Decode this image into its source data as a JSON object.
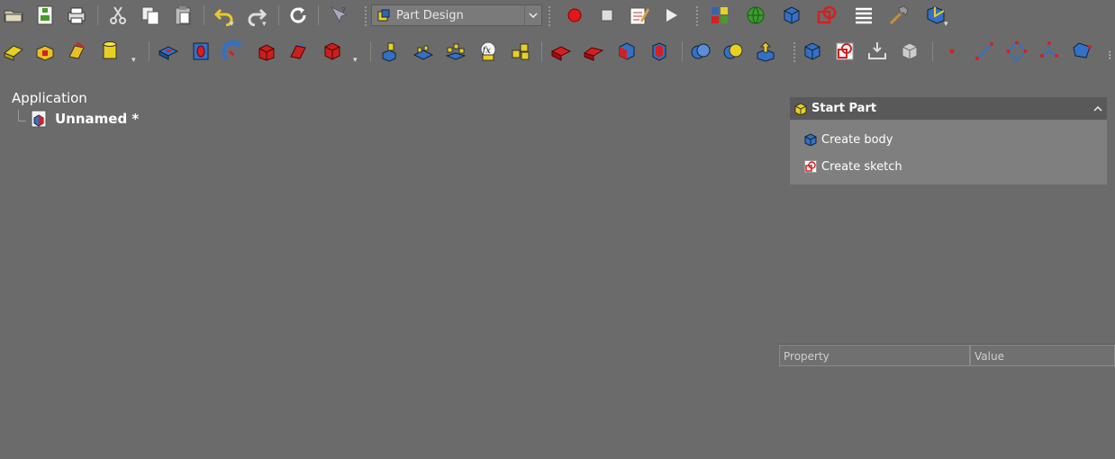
{
  "workbench_selector": {
    "selected": "Part Design"
  },
  "toolbar_main": {
    "icons": [
      "open-folder-icon",
      "save-icon",
      "print-icon",
      "cut-icon",
      "copy-icon",
      "paste-icon",
      "undo-icon",
      "redo-icon",
      "refresh-icon",
      "whats-this-icon",
      "macro-record-icon",
      "macro-stop-icon",
      "macro-edit-icon",
      "macro-run-icon",
      "part-icon",
      "sphere-icon",
      "cube-view-icon",
      "sketch-view-icon",
      "list-icon",
      "hammer-icon",
      "measure-icon"
    ]
  },
  "tree": {
    "root_label": "Application",
    "document_label": "Unnamed *"
  },
  "task_panel": {
    "title": "Start Part",
    "items": [
      {
        "label": "Create body"
      },
      {
        "label": "Create sketch"
      }
    ]
  },
  "property_view": {
    "col_property": "Property",
    "col_value": "Value"
  },
  "colors": {
    "background": "#6b6b6b",
    "accent_red": "#d42020",
    "accent_blue": "#2e66b5",
    "accent_yellow": "#e8d020"
  }
}
